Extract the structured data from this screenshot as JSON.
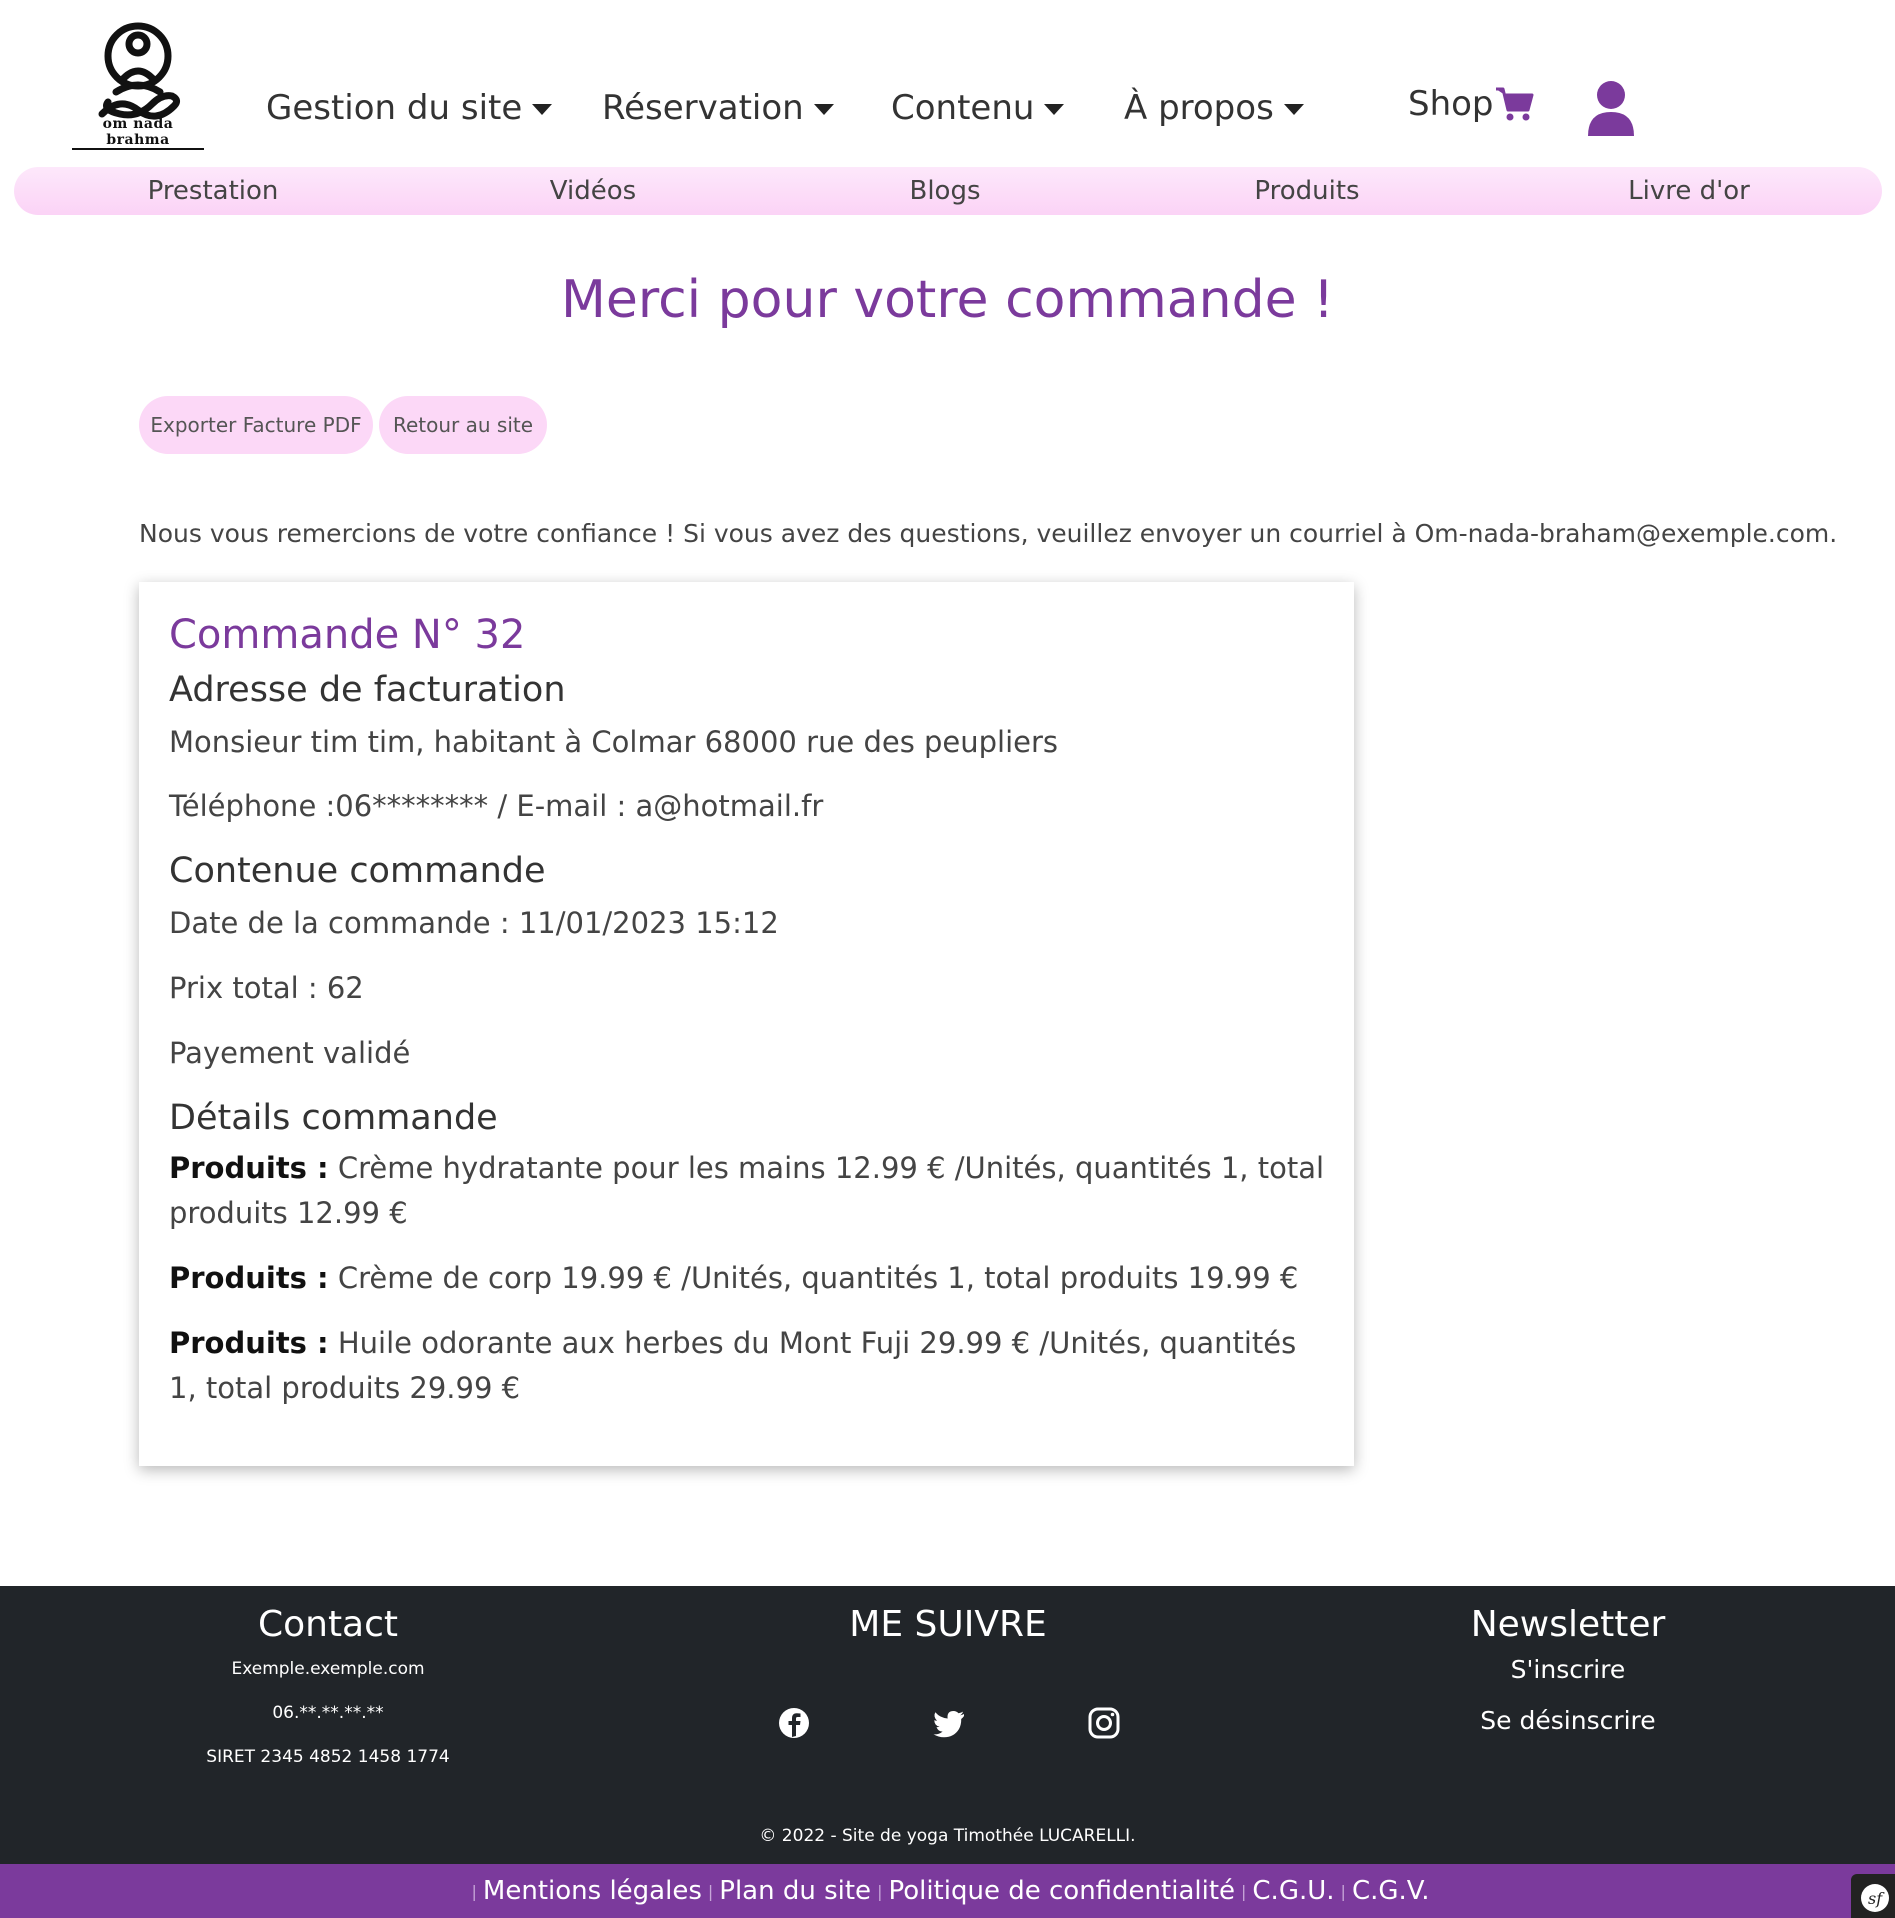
{
  "header": {
    "logo_text": "om nada brahma",
    "nav": [
      {
        "label": "Gestion du site"
      },
      {
        "label": "Réservation"
      },
      {
        "label": "Contenu"
      },
      {
        "label": "À propos"
      }
    ],
    "shop_label": "Shop"
  },
  "subnav": [
    "Prestation",
    "Vidéos",
    "Blogs",
    "Produits",
    "Livre d'or"
  ],
  "main": {
    "title": "Merci pour votre commande !",
    "buttons": {
      "export_pdf": "Exporter Facture PDF",
      "back": "Retour au site"
    },
    "intro": "Nous vous remercions de votre confiance ! Si vous avez des questions, veuillez envoyer un courriel à Om-nada-braham@exemple.com."
  },
  "order": {
    "title": "Commande N° 32",
    "billing_heading": "Adresse de facturation",
    "address": "Monsieur tim tim, habitant à Colmar 68000 rue des peupliers",
    "contact": "Téléphone :06******** / E-mail : a@hotmail.fr",
    "content_heading": "Contenue commande",
    "date": "Date de la commande : 11/01/2023 15:12",
    "total": "Prix total : 62",
    "payment": "Payement validé",
    "details_heading": "Détails commande",
    "product_label": "Produits :",
    "products": [
      " Crème hydratante pour les mains 12.99 € /Unités, quantités 1, total produits 12.99 €",
      " Crème de corp 19.99 € /Unités, quantités 1, total produits 19.99 €",
      " Huile odorante aux herbes du Mont Fuji 29.99 € /Unités, quantités 1, total produits 29.99 €"
    ]
  },
  "footer": {
    "contact": {
      "title": "Contact",
      "email": "Exemple.exemple.com",
      "phone": "06.**.**.**.**",
      "siret": "SIRET 2345 4852 1458 1774"
    },
    "follow": {
      "title": "ME SUIVRE",
      "icons": [
        "facebook-icon",
        "twitter-icon",
        "instagram-icon"
      ]
    },
    "newsletter": {
      "title": "Newsletter",
      "subscribe": "S'inscrire",
      "unsubscribe": "Se désinscrire"
    },
    "copyright": "© 2022 - Site de yoga Timothée LUCARELLI.",
    "links": [
      "Mentions légales",
      "Plan du site",
      "Politique de confidentialité",
      "C.G.U.",
      "C.G.V."
    ]
  },
  "colors": {
    "accent": "#7b3a9c",
    "subnav_bg": "#fbd3f6",
    "button_bg": "#fcd8f7",
    "footer_bg": "#212529"
  }
}
